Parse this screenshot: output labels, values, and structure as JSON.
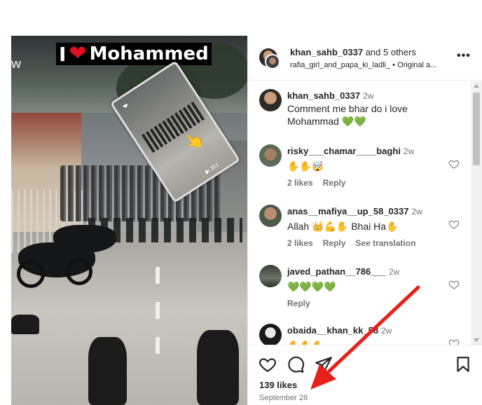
{
  "media": {
    "overlay_title_prefix": "I",
    "overlay_title_heart": "❤",
    "overlay_title_name": "Mohammed",
    "edge_letter": "w",
    "inset_heart": "❤",
    "inset_hand": "👆",
    "inset_count": "▶ 351"
  },
  "header": {
    "username": "khan_sahb_0337",
    "and_others": " and 5 others",
    "subline": "rafia_girl_and_papa_ki_ladli_ • Original a...",
    "more_icon": "more-horizontal-icon"
  },
  "comments": [
    {
      "username": "khan_sahb_0337",
      "time": "2w",
      "text": "Comment me bhar do i love Mohammad 💚💚",
      "likes": "",
      "reply": "",
      "translation": ""
    },
    {
      "username": "risky___chamar____baghi",
      "time": "2w",
      "text": "✋✋🤯",
      "likes": "2 likes",
      "reply": "Reply",
      "translation": ""
    },
    {
      "username": "anas__mafiya__up_58_0337",
      "time": "2w",
      "text": "Allah 👑💪✋ Bhai Ha✋",
      "likes": "2 likes",
      "reply": "Reply",
      "translation": "See translation"
    },
    {
      "username": "javed_pathan__786___",
      "time": "2w",
      "text": "💚💚💚💚",
      "likes": "",
      "reply": "Reply",
      "translation": ""
    },
    {
      "username": "obaida__khan_kk_58",
      "time": "2w",
      "text": "✋✋✋",
      "likes": "",
      "reply": "",
      "translation": ""
    }
  ],
  "footer": {
    "likes": "139 likes",
    "date": "September 28"
  },
  "colors": {
    "annotation_arrow": "#e8201a",
    "text_primary": "#262626",
    "text_secondary": "#737373",
    "divider": "#efefef"
  }
}
